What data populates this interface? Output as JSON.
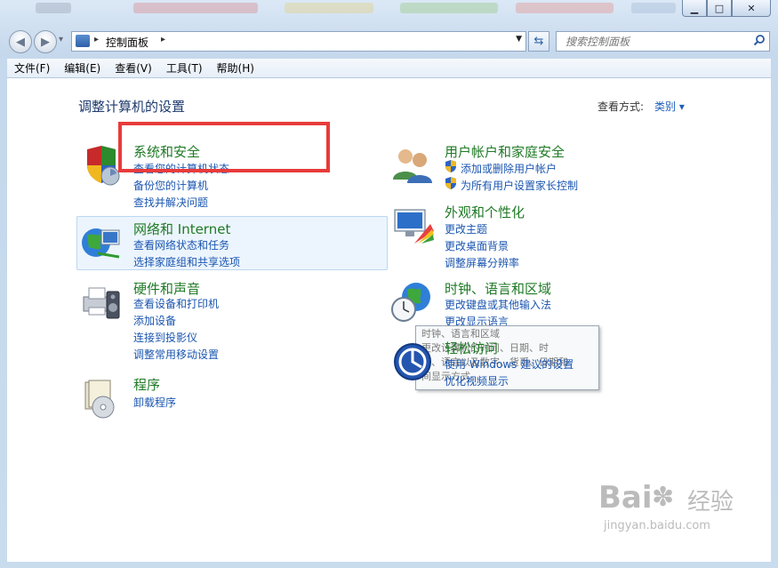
{
  "titlebar": {
    "minimize_glyph": "▁",
    "maximize_glyph": "□",
    "close_glyph": "✕"
  },
  "nav": {
    "back_glyph": "◀",
    "forward_glyph": "▶",
    "recent_glyph": "▾"
  },
  "address": {
    "separator": "▸",
    "crumb": "控制面板",
    "dropdown_glyph": "▼"
  },
  "refresh_glyph": "⇆",
  "search": {
    "placeholder": "搜索控制面板",
    "icon": "search-icon"
  },
  "menu": [
    "文件(F)",
    "编辑(E)",
    "查看(V)",
    "工具(T)",
    "帮助(H)"
  ],
  "page": {
    "title": "调整计算机的设置",
    "view_by_label": "查看方式:",
    "view_by_value": "类别 ▾"
  },
  "categories": {
    "system": {
      "title": "系统和安全",
      "links": [
        "查看您的计算机状态",
        "备份您的计算机",
        "查找并解决问题"
      ]
    },
    "network": {
      "title": "网络和 Internet",
      "links": [
        "查看网络状态和任务",
        "选择家庭组和共享选项"
      ]
    },
    "hardware": {
      "title": "硬件和声音",
      "links": [
        "查看设备和打印机",
        "添加设备",
        "连接到投影仪",
        "调整常用移动设置"
      ]
    },
    "programs": {
      "title": "程序",
      "links": [
        "卸载程序"
      ]
    },
    "users": {
      "title": "用户帐户和家庭安全",
      "links": [
        "添加或删除用户帐户",
        "为所有用户设置家长控制"
      ]
    },
    "appearance": {
      "title": "外观和个性化",
      "links": [
        "更改主题",
        "更改桌面背景",
        "调整屏幕分辨率"
      ]
    },
    "clock": {
      "title": "时钟、语言和区域",
      "links": [
        "更改键盘或其他输入法",
        "更改显示语言"
      ]
    },
    "ease": {
      "title": "轻松访问",
      "links": [
        "使用 Windows 建议的设置",
        "优化视频显示"
      ]
    }
  },
  "tooltip": {
    "line1": "时钟、语言和区域",
    "line2": "更改计算机的时间、日期、时",
    "line3": "区、语言以及数字、货币、日期和",
    "line4": "间显示方式。"
  },
  "watermark": {
    "brand": "Bai",
    "brand2": "经验",
    "url": "jingyan.baidu.com"
  },
  "colors": {
    "link": "#1a55b0",
    "category_title": "#1f7a25",
    "highlight_box": "#e83b3b"
  }
}
